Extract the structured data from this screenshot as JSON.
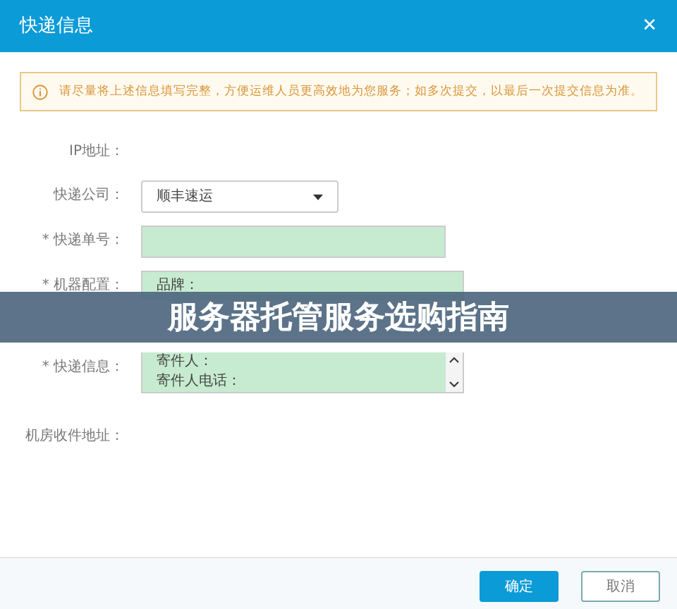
{
  "dialog": {
    "title": "快递信息",
    "close": "✕"
  },
  "alert": {
    "text": "请尽量将上述信息填写完整，方便运维人员更高效地为您服务；如多次提交，以最后一次提交信息为准。"
  },
  "fields": [
    {
      "kind": "static",
      "label": "IP地址："
    },
    {
      "kind": "select",
      "label": "快递公司：",
      "value": "顺丰速运"
    },
    {
      "kind": "input",
      "label": "* 快递单号："
    },
    {
      "kind": "textarea",
      "label": "* 机器配置：",
      "lines": [
        "品牌："
      ]
    },
    {
      "kind": "textarea",
      "label": "* 快递信息：",
      "lines": [
        "寄件人：",
        "寄件人电话："
      ],
      "scroll": true
    },
    {
      "kind": "static",
      "label": "机房收件地址："
    }
  ],
  "banner": {
    "text": "服务器托管服务选购指南"
  },
  "buttons": [
    {
      "label": "确定",
      "kind": "primary"
    },
    {
      "label": "取消",
      "kind": "secondary"
    }
  ]
}
